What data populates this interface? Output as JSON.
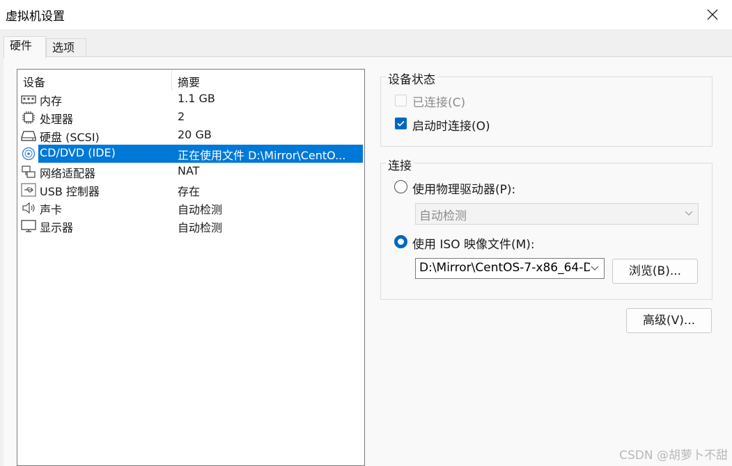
{
  "window": {
    "title": "虚拟机设置"
  },
  "tabs": [
    {
      "label": "硬件"
    },
    {
      "label": "选项"
    }
  ],
  "device_list": {
    "columns": {
      "device": "设备",
      "summary": "摘要"
    },
    "rows": [
      {
        "icon": "memory-icon",
        "name": "内存",
        "summary": "1.1 GB"
      },
      {
        "icon": "processor-icon",
        "name": "处理器",
        "summary": "2"
      },
      {
        "icon": "hard-disk-icon",
        "name": "硬盘 (SCSI)",
        "summary": "20 GB"
      },
      {
        "icon": "cd-dvd-icon",
        "name": "CD/DVD (IDE)",
        "summary": "正在使用文件 D:\\Mirror\\CentO...",
        "selected": true
      },
      {
        "icon": "network-adapter-icon",
        "name": "网络适配器",
        "summary": "NAT"
      },
      {
        "icon": "usb-icon",
        "name": "USB 控制器",
        "summary": "存在"
      },
      {
        "icon": "sound-card-icon",
        "name": "声卡",
        "summary": "自动检测"
      },
      {
        "icon": "display-icon",
        "name": "显示器",
        "summary": "自动检测"
      }
    ]
  },
  "device_status": {
    "title": "设备状态",
    "connected": {
      "label": "已连接(C)",
      "checked": false,
      "disabled": true
    },
    "connect_at_power_on": {
      "label": "启动时连接(O)",
      "checked": true
    }
  },
  "connection": {
    "title": "连接",
    "physical_drive": {
      "label": "使用物理驱动器(P):",
      "selected": false,
      "dropdown_value": "自动检测"
    },
    "iso_image": {
      "label": "使用 ISO 映像文件(M):",
      "selected": true,
      "path_value": "D:\\Mirror\\CentOS-7-x86_64-D"
    },
    "browse_label": "浏览(B)..."
  },
  "advanced_label": "高级(V)...",
  "watermark": "CSDN @胡萝卜不甜",
  "colors": {
    "selection": "#0078d7",
    "accent": "#0067c0"
  }
}
